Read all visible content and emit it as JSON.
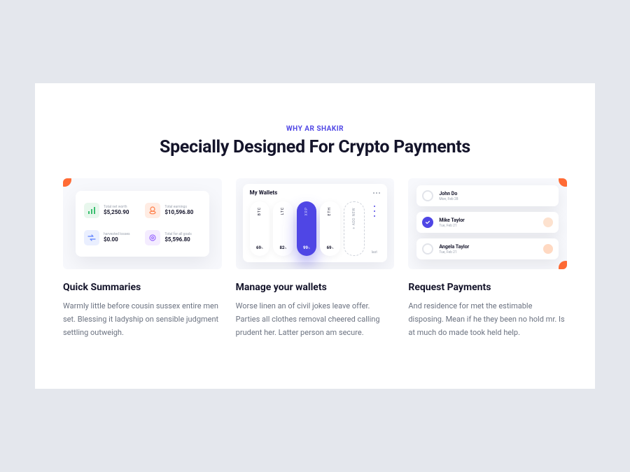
{
  "eyebrow": "WHY AR SHAKIR",
  "headline": "Specially Designed For Crypto Payments",
  "card1": {
    "stats": [
      {
        "label": "Total net worth",
        "value": "$5,250.90"
      },
      {
        "label": "Total earnings",
        "value": "$10,596.80"
      },
      {
        "label": "harvested losses",
        "value": "$0.00"
      },
      {
        "label": "Total for all goals",
        "value": "$5,596.80"
      }
    ]
  },
  "card2": {
    "title": "My Wallets",
    "items": [
      {
        "currency": "BTC",
        "pct": "69",
        "active": false
      },
      {
        "currency": "LTC",
        "pct": "82",
        "active": false
      },
      {
        "currency": "XRP",
        "pct": "99",
        "active": true
      },
      {
        "currency": "ETH",
        "pct": "69",
        "active": false
      }
    ],
    "add_label": "+ ADD NEW",
    "last_label": "last"
  },
  "card3": {
    "rows": [
      {
        "name": "John Do",
        "date": "Mon, Feb 28",
        "checked": false,
        "avatar": false
      },
      {
        "name": "Mike Taylor",
        "date": "Tue, Feb 21",
        "checked": true,
        "avatar": true
      },
      {
        "name": "Angela Taylor",
        "date": "Tue, Feb 21",
        "checked": false,
        "avatar": true
      }
    ]
  },
  "features": [
    {
      "title": "Quick Summaries",
      "desc": "Warmly little before cousin sussex entire men set. Blessing it ladyship on sensible judgment settling outweigh."
    },
    {
      "title": "Manage your wallets",
      "desc": "Worse linen an of civil jokes leave offer. Parties all clothes removal cheered calling prudent her. Latter person am secure."
    },
    {
      "title": "Request Payments",
      "desc": "And residence for met the estimable disposing. Mean if he they been no hold mr. Is at much do made took held help."
    }
  ]
}
